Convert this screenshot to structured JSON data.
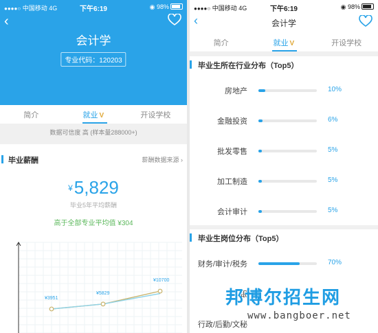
{
  "colors": {
    "accent": "#2aa3e8",
    "badge": "#e0a93a",
    "green": "#5cb85c",
    "chart_line_a": "#c8b26a",
    "chart_line_b": "#8fd3e8"
  },
  "status": {
    "carrier": "中国移动",
    "network": "4G",
    "time": "下午6:19",
    "battery": "98%"
  },
  "left": {
    "title": "会计学",
    "code_label": "专业代码：120203",
    "tabs": [
      "简介",
      "就业",
      "开设学校"
    ],
    "tab_badge": "V",
    "confidence": "数据可信度  高 (样本量288000+)",
    "salary_section": {
      "title": "毕业薪酬",
      "link": "薪酬数据来源"
    },
    "salary": {
      "currency": "¥",
      "value": "5,829",
      "sub": "毕业5年平均薪酬",
      "compare": "高于全部专业平均值 ¥304"
    },
    "chart_data": {
      "type": "line",
      "x": [
        1,
        2,
        3
      ],
      "series": [
        {
          "values": [
            3951,
            5829,
            10700
          ]
        },
        {
          "values": [
            3951,
            5829,
            9800
          ]
        }
      ],
      "data_labels": [
        "¥3951",
        "¥5829",
        "¥10700"
      ],
      "grid": true
    }
  },
  "right": {
    "title": "会计学",
    "tabs": [
      "简介",
      "就业",
      "开设学校"
    ],
    "tab_badge": "V",
    "industry_section": "毕业生所在行业分布（Top5）",
    "industries": [
      {
        "label": "房地产",
        "pct": "10%",
        "value": 10
      },
      {
        "label": "金融投资",
        "pct": "6%",
        "value": 6
      },
      {
        "label": "批发零售",
        "pct": "5%",
        "value": 5
      },
      {
        "label": "加工制造",
        "pct": "5%",
        "value": 5
      },
      {
        "label": "会计审计",
        "pct": "5%",
        "value": 5
      }
    ],
    "position_section": "毕业生岗位分布（Top5）",
    "positions": [
      {
        "label": "财务/审计/税务",
        "pct": "70%",
        "value": 70
      },
      {
        "label": "银",
        "pct": "",
        "value": 0
      },
      {
        "label": "行政/后勤/文秘",
        "pct": "",
        "value": 0
      }
    ]
  },
  "watermark": {
    "brand": "邦博尔招生网",
    "url": "www.bangboer.net"
  }
}
